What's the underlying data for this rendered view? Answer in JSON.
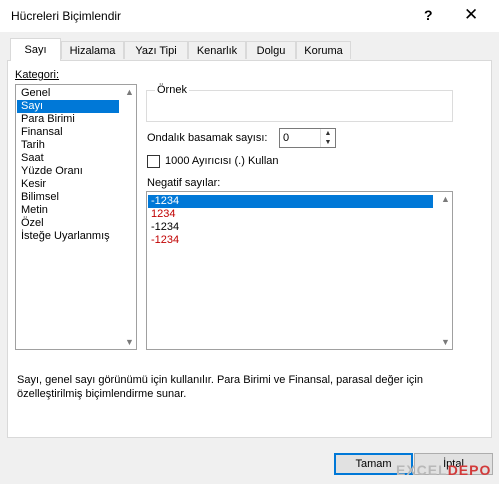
{
  "window": {
    "title": "Hücreleri Biçimlendir",
    "help_label": "?",
    "close_label": "✕"
  },
  "tabs": [
    {
      "label": "Sayı",
      "active": true
    },
    {
      "label": "Hizalama",
      "active": false
    },
    {
      "label": "Yazı Tipi",
      "active": false
    },
    {
      "label": "Kenarlık",
      "active": false
    },
    {
      "label": "Dolgu",
      "active": false
    },
    {
      "label": "Koruma",
      "active": false
    }
  ],
  "category": {
    "label": "Kategori:",
    "items": [
      "Genel",
      "Sayı",
      "Para Birimi",
      "Finansal",
      "Tarih",
      "Saat",
      "Yüzde Oranı",
      "Kesir",
      "Bilimsel",
      "Metin",
      "Özel",
      "İsteğe Uyarlanmış"
    ],
    "selected": "Sayı"
  },
  "sample": {
    "label": "Örnek",
    "value": ""
  },
  "decimal_places": {
    "label": "Ondalık basamak sayısı:",
    "value": "0",
    "up_glyph": "▲",
    "down_glyph": "▼"
  },
  "separator": {
    "label": "1000 Ayırıcısı (.) Kullan",
    "checked": false
  },
  "negative": {
    "label": "Negatif sayılar:",
    "items": [
      {
        "text": "-1234",
        "color": "#ffffff",
        "selected": true
      },
      {
        "text": "1234",
        "color": "#c00000",
        "selected": false
      },
      {
        "text": "-1234",
        "color": "#000000",
        "selected": false
      },
      {
        "text": "-1234",
        "color": "#c00000",
        "selected": false
      }
    ]
  },
  "scroll": {
    "up_glyph": "▲",
    "down_glyph": "▼"
  },
  "description": "Sayı, genel sayı görünümü için kullanılır. Para Birimi ve Finansal, parasal değer için özelleştirilmiş biçimlendirme sunar.",
  "buttons": {
    "ok": "Tamam",
    "cancel": "İptal"
  },
  "watermark": {
    "part1": "EXCEL",
    "part2": "DEPO"
  },
  "colors": {
    "selection": "#0078d7",
    "accent_red": "#c00000"
  }
}
